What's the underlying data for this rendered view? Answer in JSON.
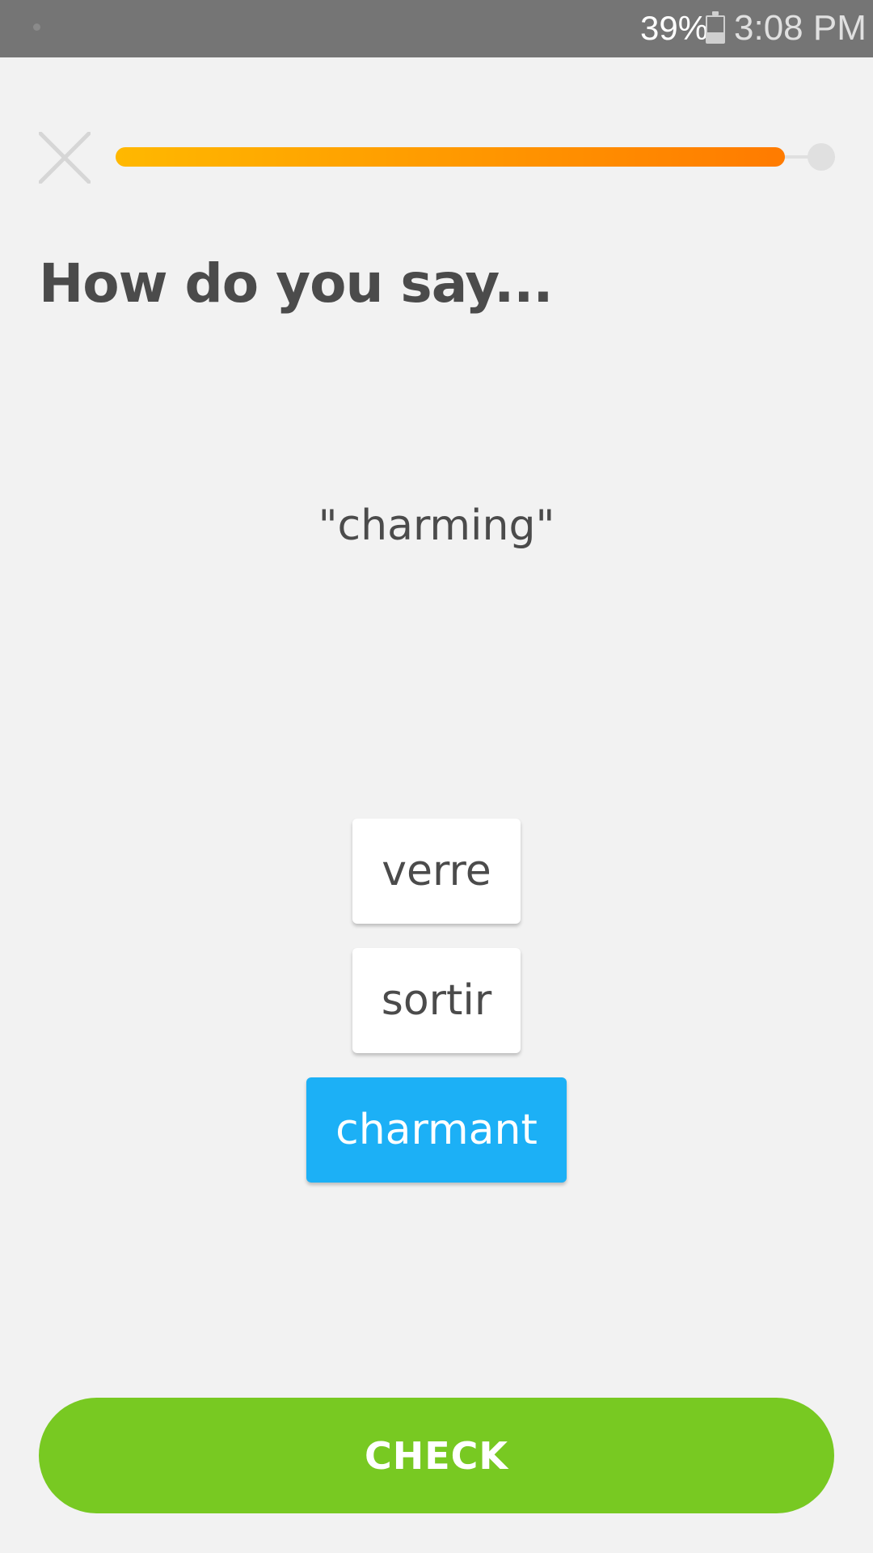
{
  "status_bar": {
    "battery_percent": "39%",
    "battery_level": 0.39,
    "time": "3:08 PM"
  },
  "lesson": {
    "progress": 0.93,
    "progress_colors": {
      "start": "#ffb800",
      "end": "#ff7b00"
    }
  },
  "prompt": {
    "title": "How do you say...",
    "word": "\"charming\""
  },
  "options": [
    {
      "label": "verre",
      "selected": false
    },
    {
      "label": "sortir",
      "selected": false
    },
    {
      "label": "charmant",
      "selected": true
    }
  ],
  "actions": {
    "check_label": "CHECK"
  },
  "colors": {
    "selected": "#1cb0f6",
    "check_button": "#78c922",
    "text": "#4b4b4b"
  },
  "icons": {
    "close": "close-icon",
    "battery": "battery-icon"
  }
}
